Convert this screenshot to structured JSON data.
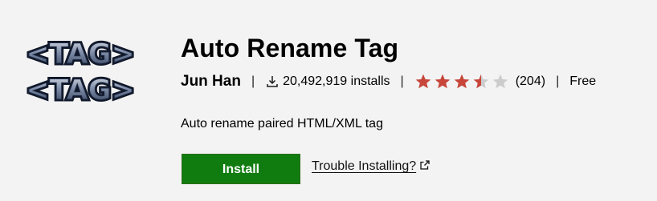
{
  "extension": {
    "logo_text": "<TAG>",
    "title": "Auto Rename Tag",
    "publisher": "Jun Han",
    "separator": "|",
    "install_icon": "download-icon",
    "installs_text": "20,492,919 installs",
    "rating": {
      "value": 3.5,
      "max": 5,
      "count_text": "(204)",
      "filled_color": "#c8453a",
      "empty_color": "#cccccc"
    },
    "price": "Free",
    "description": "Auto rename paired HTML/XML tag",
    "install_button": {
      "label": "Install",
      "color": "#107c10"
    },
    "trouble_link": {
      "label": "Trouble Installing?",
      "icon": "external-link-icon"
    }
  }
}
